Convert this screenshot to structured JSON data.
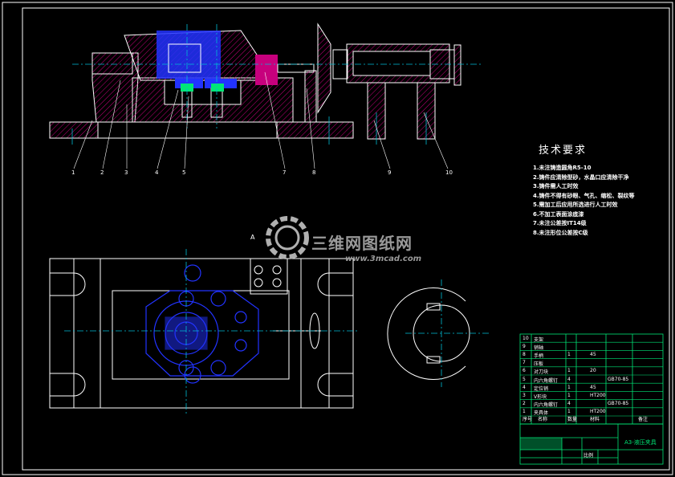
{
  "tech_requirements": {
    "title": "技术要求",
    "items": [
      "1.未注铸造圆角R5-10",
      "2.铸件应清除型砂，水晶口应清除干净",
      "3.铸件需人工时效",
      "4.铸件不得有砂眼、气孔、缩松、裂纹等",
      "5.需加工后应用所选进行人工时效",
      "6.不加工表面涂底漆",
      "7.未注公差按IT14级",
      "8.未注形位公差按C级"
    ]
  },
  "watermark": {
    "brand": "三维网图纸网",
    "url": "www.3mcad.com"
  },
  "leaders": [
    "1",
    "2",
    "3",
    "4",
    "5",
    "7",
    "8",
    "9",
    "10"
  ],
  "bom": {
    "rows": [
      {
        "no": "10",
        "name": "支架"
      },
      {
        "no": "9",
        "name": "销轴"
      },
      {
        "no": "8",
        "name": "手柄",
        "qty": "1",
        "mat": "45"
      },
      {
        "no": "7",
        "name": "压板"
      },
      {
        "no": "6",
        "name": "对刀块",
        "qty": "1",
        "mat": "20"
      },
      {
        "no": "5",
        "name": "内六角螺钉",
        "qty": "4",
        "note": "GB70-85"
      },
      {
        "no": "4",
        "name": "定位销",
        "qty": "1",
        "mat": "45"
      },
      {
        "no": "3",
        "name": "V形块",
        "qty": "1",
        "mat": "HT200"
      },
      {
        "no": "2",
        "name": "内六角螺钉",
        "qty": "4",
        "note": "GB70-85"
      },
      {
        "no": "1",
        "name": "夹具体",
        "qty": "1",
        "mat": "HT200"
      }
    ],
    "header": [
      "序号",
      "名称",
      "数量",
      "材料",
      "备注"
    ]
  },
  "title_block": {
    "drawing_name": "A3-液压夹具",
    "scale_label": "比例"
  },
  "colors": {
    "background": "#000000",
    "outline": "#ffffff",
    "hatch": "#c7007d",
    "detail": "#2233ff",
    "green": "#00e676",
    "centerline": "#00bcd4"
  }
}
